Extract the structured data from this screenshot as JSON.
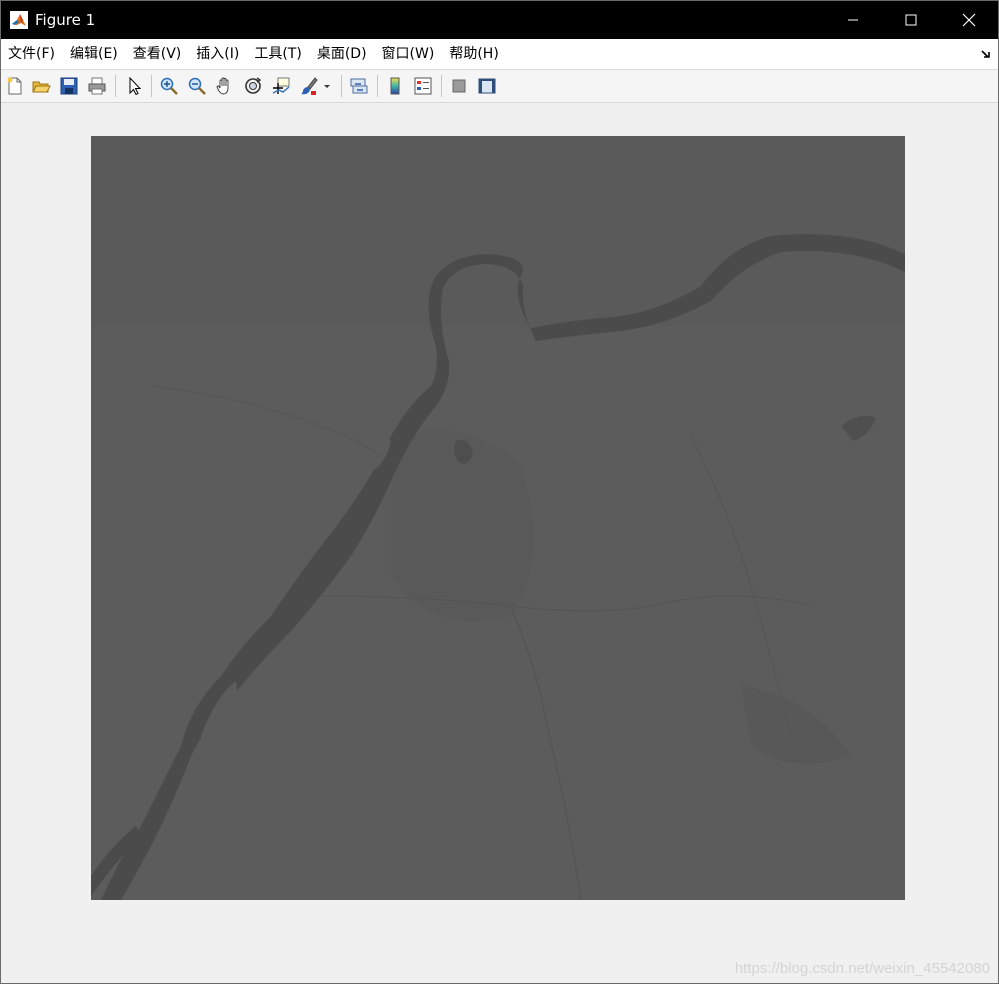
{
  "window": {
    "title": "Figure 1",
    "icon": "matlab-icon",
    "controls": [
      "minimize-icon",
      "maximize-icon",
      "close-icon"
    ]
  },
  "menu": {
    "items": [
      {
        "label": "文件(F)"
      },
      {
        "label": "编辑(E)"
      },
      {
        "label": "查看(V)"
      },
      {
        "label": "插入(I)"
      },
      {
        "label": "工具(T)"
      },
      {
        "label": "桌面(D)"
      },
      {
        "label": "窗口(W)"
      },
      {
        "label": "帮助(H)"
      }
    ],
    "dock_icon": "dock-arrow-icon"
  },
  "toolbar": {
    "buttons": [
      "new-figure-icon",
      "open-file-icon",
      "save-icon",
      "print-icon",
      "select-arrow-icon",
      "zoom-in-icon",
      "zoom-out-icon",
      "pan-hand-icon",
      "rotate-3d-icon",
      "data-cursor-icon",
      "brush-icon",
      "brush-dropdown-icon",
      "link-plot-icon",
      "colorbar-icon",
      "legend-icon",
      "hide-plot-tools-icon",
      "show-plot-tools-icon"
    ]
  },
  "figure": {
    "image_description_colors": {
      "land": "#5b5b5b",
      "river": "#4a4a4a"
    }
  },
  "watermark": "https://blog.csdn.net/weixin_45542080",
  "colors": {
    "titlebar": "#000000",
    "window_bg": "#f0f0f0",
    "image_gray": "#5b5b5b"
  }
}
